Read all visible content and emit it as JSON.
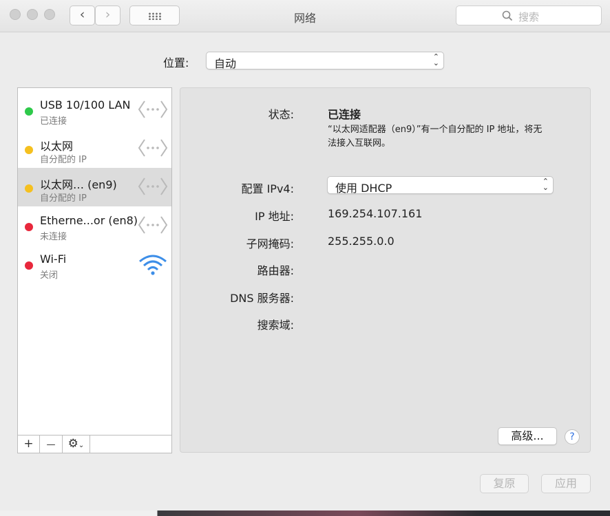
{
  "window": {
    "title": "网络",
    "search_placeholder": "搜索"
  },
  "location": {
    "label": "位置:",
    "value": "自动"
  },
  "services": [
    {
      "name": "USB 10/100 LAN",
      "status": "已连接",
      "dot_color": "#2ec94a",
      "icon": "ethernet-icon",
      "selected": false
    },
    {
      "name": "以太网",
      "status": "自分配的 IP",
      "dot_color": "#f5c01f",
      "icon": "ethernet-icon",
      "selected": false
    },
    {
      "name": "以太网… (en9)",
      "status": "自分配的 IP",
      "dot_color": "#f5c01f",
      "icon": "ethernet-icon",
      "selected": true
    },
    {
      "name": "Etherne...or (en8)",
      "status": "未连接",
      "dot_color": "#e8283c",
      "icon": "ethernet-icon",
      "selected": false
    },
    {
      "name": "Wi-Fi",
      "status": "关闭",
      "dot_color": "#e8283c",
      "icon": "wifi-icon",
      "selected": false
    }
  ],
  "list_toolbar": {
    "add": "+",
    "remove": "—"
  },
  "detail": {
    "status_label": "状态:",
    "status_value": "已连接",
    "status_description": "“以太网适配器（en9）”有一个自分配的 IP 地址，将无法接入互联网。",
    "ipv4_label": "配置 IPv4:",
    "ipv4_value": "使用 DHCP",
    "ip_label": "IP 地址:",
    "ip_value": "169.254.107.161",
    "subnet_label": "子网掩码:",
    "subnet_value": "255.255.0.0",
    "router_label": "路由器:",
    "dns_label": "DNS 服务器:",
    "search_domain_label": "搜索域:",
    "advanced_button": "高级...",
    "help": "?"
  },
  "footer": {
    "revert": "复原",
    "apply": "应用"
  }
}
